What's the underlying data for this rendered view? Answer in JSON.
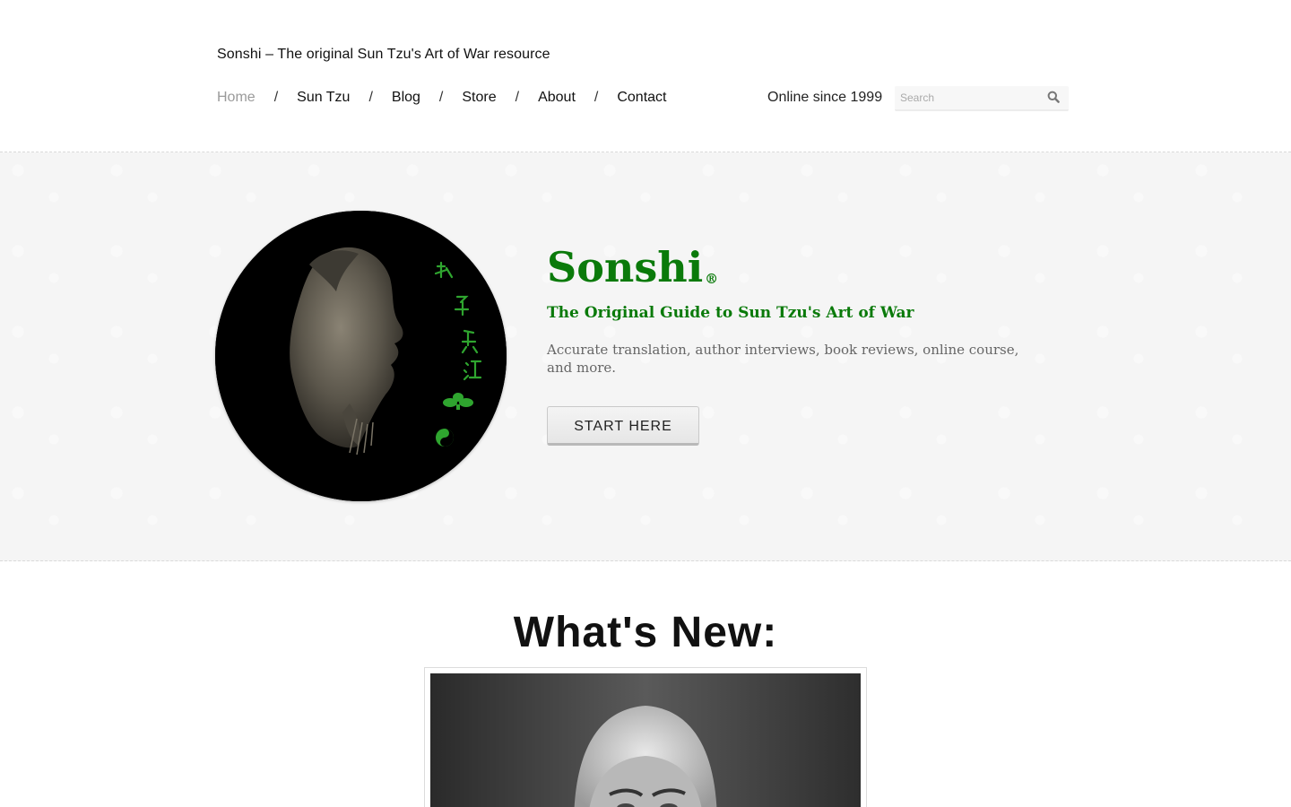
{
  "header": {
    "site_title": "Sonshi – The original Sun Tzu's Art of War resource",
    "nav": [
      {
        "label": "Home",
        "active": true
      },
      {
        "label": "Sun Tzu",
        "active": false
      },
      {
        "label": "Blog",
        "active": false
      },
      {
        "label": "Store",
        "active": false
      },
      {
        "label": "About",
        "active": false
      },
      {
        "label": "Contact",
        "active": false
      }
    ],
    "nav_separator": "/",
    "online_since": "Online since 1999",
    "search": {
      "placeholder": "Search",
      "value": ""
    }
  },
  "hero": {
    "brand": "Sonshi",
    "registered_mark": "®",
    "tagline": "The Original Guide to Sun Tzu's Art of War",
    "description": "Accurate translation, author interviews, book reviews, online course, and more.",
    "cta_label": "START HERE",
    "medallion_image": "sun-tzu-sculpture-portrait"
  },
  "whats_new": {
    "title": "What's New:",
    "feature_image": "black-and-white-portrait-photo"
  },
  "colors": {
    "brand_green": "#0a7a0a",
    "hero_bg": "#f5f5f5",
    "muted_text": "#666666",
    "nav_active": "#9a9a9a"
  }
}
